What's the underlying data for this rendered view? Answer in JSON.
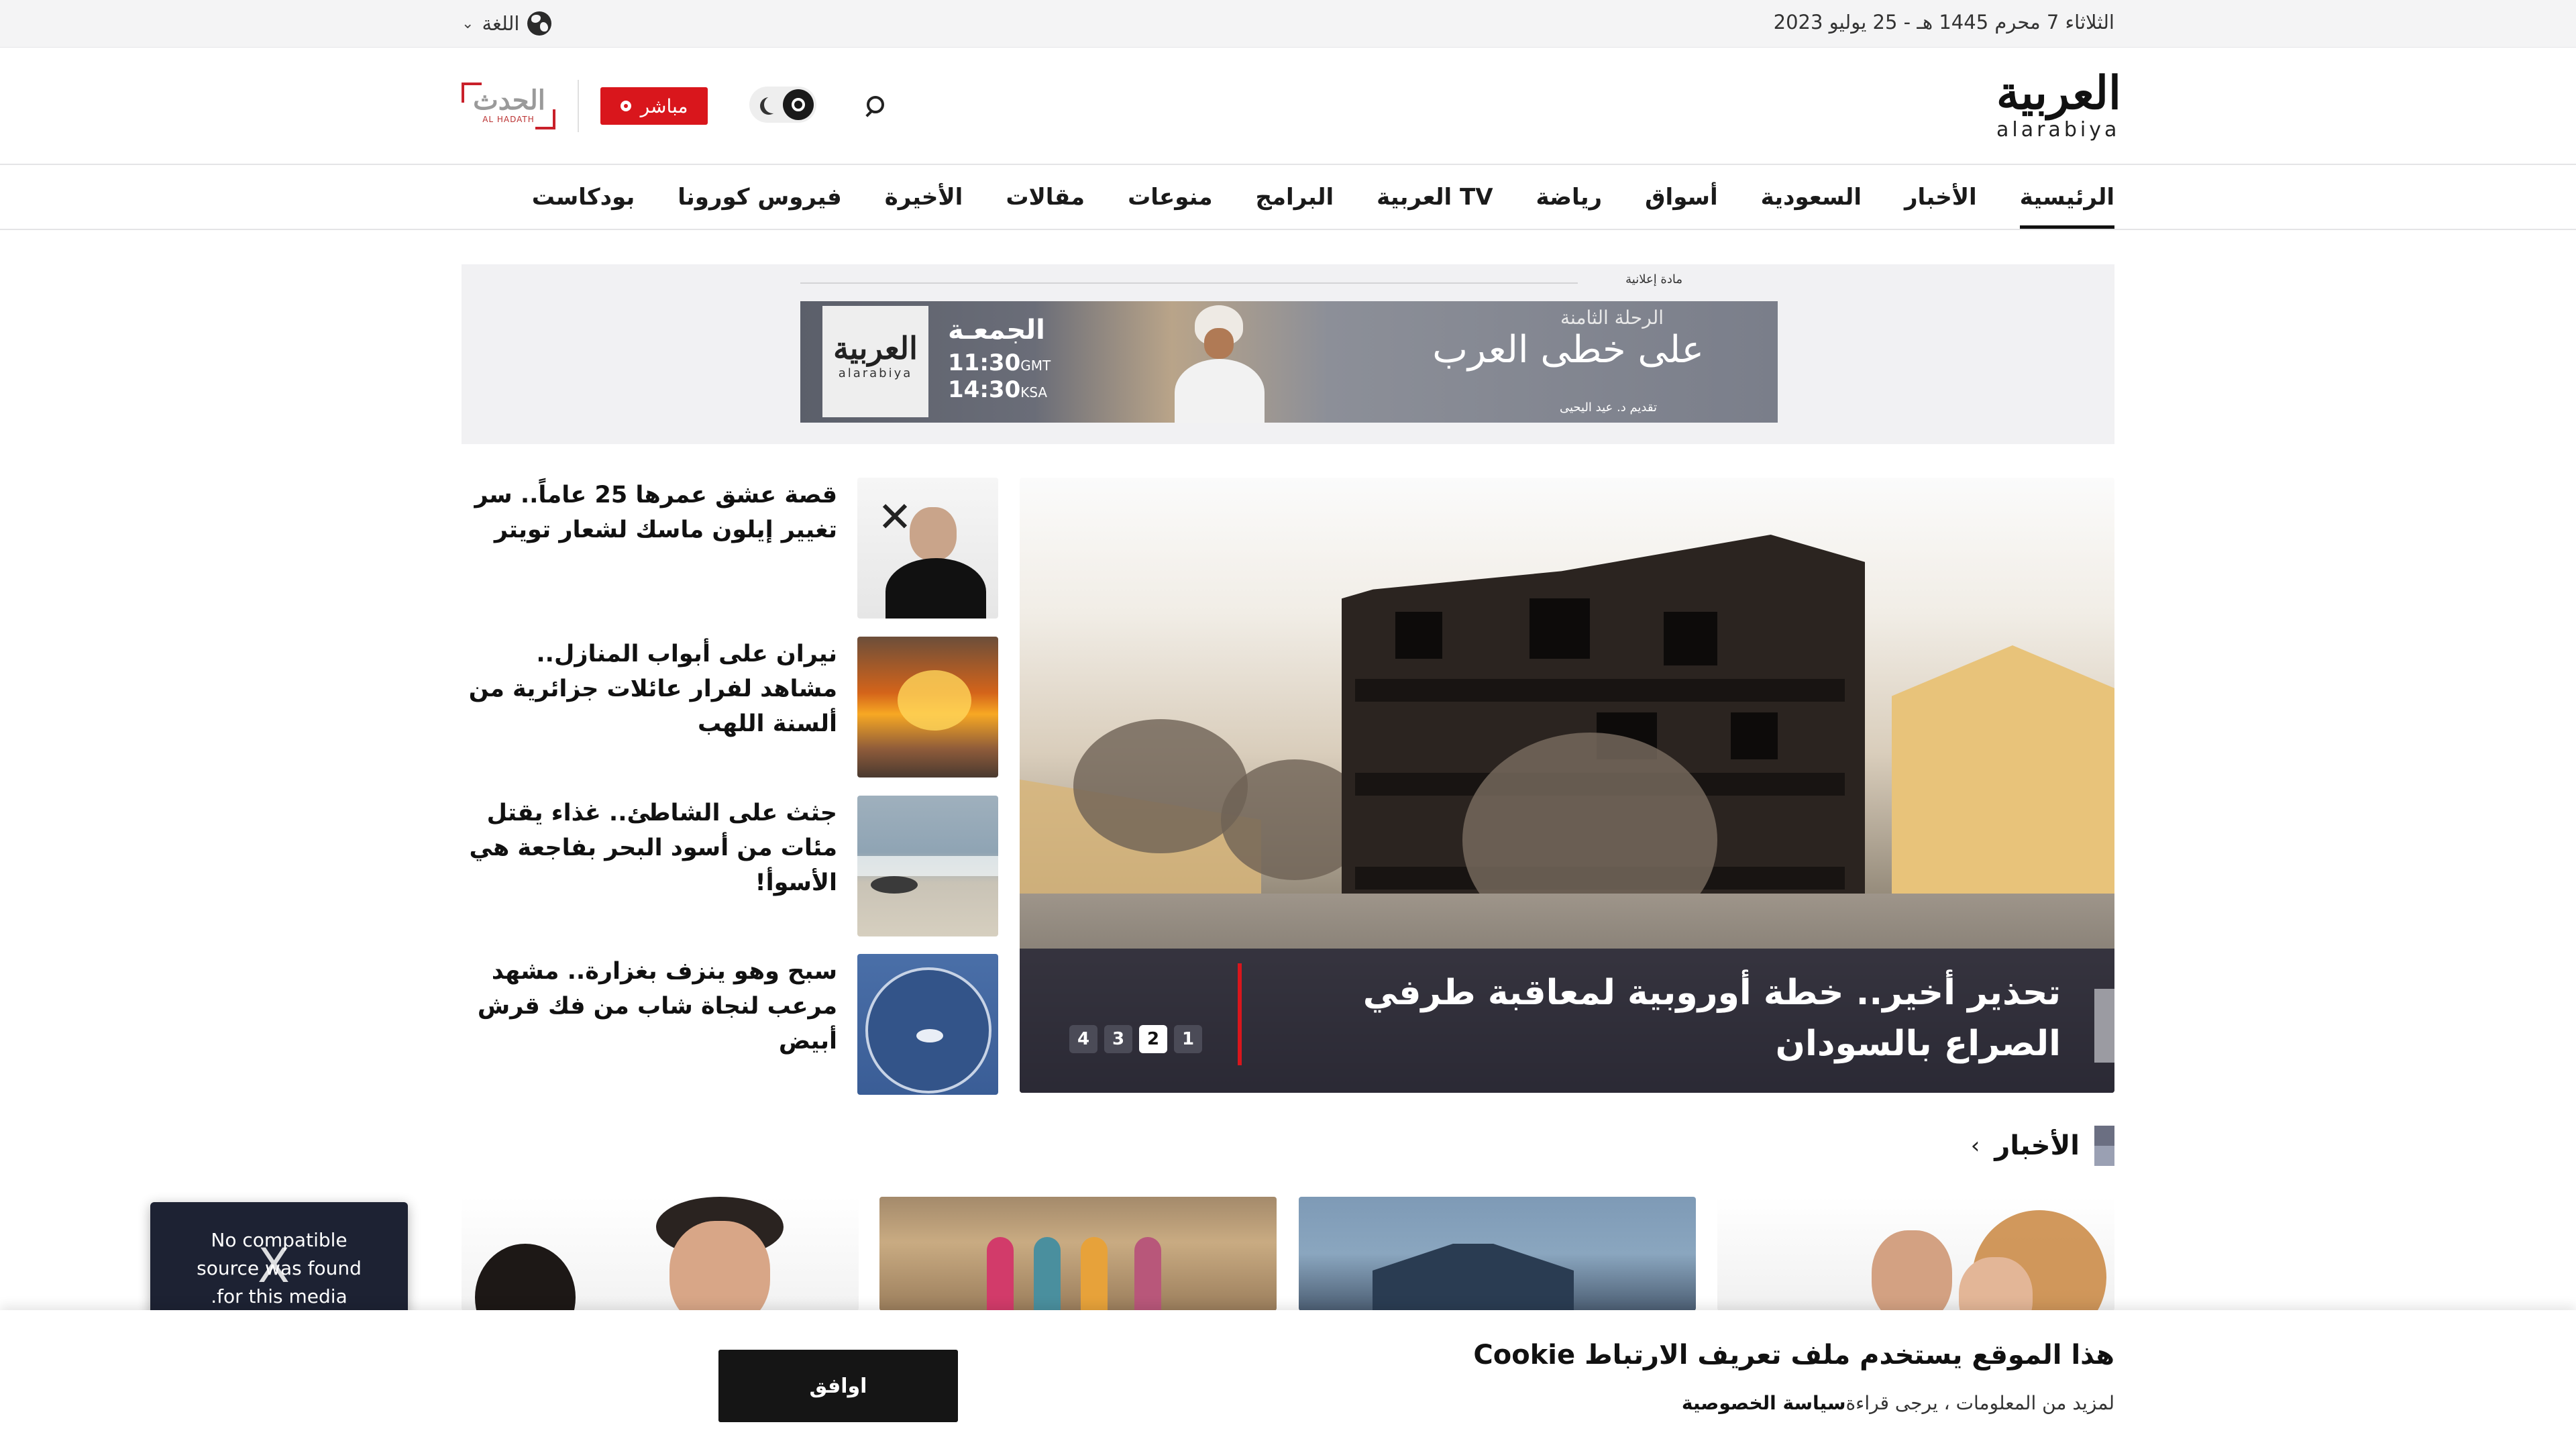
{
  "topbar": {
    "date": "الثلاثاء 7 محرم 1445 هـ - 25 يوليو 2023",
    "language_label": "اللغة"
  },
  "header": {
    "logo_ar": "العربية",
    "logo_en": "alarabiya",
    "live_label": "مباشر",
    "hadath_logo_ar": "الحدث",
    "hadath_logo_en": "AL HADATH"
  },
  "nav": {
    "items": [
      {
        "label": "الرئيسية",
        "active": true
      },
      {
        "label": "الأخبار"
      },
      {
        "label": "السعودية"
      },
      {
        "label": "أسواق"
      },
      {
        "label": "رياضة"
      },
      {
        "label": "العربية TV"
      },
      {
        "label": "البرامج"
      },
      {
        "label": "منوعات"
      },
      {
        "label": "مقالات"
      },
      {
        "label": "الأخيرة"
      },
      {
        "label": "فيروس كورونا"
      },
      {
        "label": "بودكاست"
      }
    ]
  },
  "ad": {
    "label": "مادة إعلانية",
    "day": "الجمعـة",
    "time_gmt": "11:30",
    "gmt_suffix": "GMT",
    "time_ksa": "14:30",
    "ksa_suffix": "KSA",
    "show_subtitle": "الرحلة الثامنة",
    "show_title": "على خطى العرب",
    "show_host": "تقديم د. عيد اليحيى",
    "logo_ar": "العربية",
    "logo_en": "alarabiya"
  },
  "hero": {
    "title": "تحذير أخير.. خطة أوروبية لمعاقبة طرفي الصراع بالسودان",
    "slides": [
      "1",
      "2",
      "3",
      "4"
    ],
    "active_slide": "2"
  },
  "side_news": [
    {
      "title": "قصة عشق عمرها 25 عاماً.. سر تغيير إيلون ماسك لشعار تويتر",
      "thumb": "elon-musk-x"
    },
    {
      "title": "نيران على أبواب المنازل.. مشاهد لفرار عائلات جزائرية من ألسنة اللهب",
      "thumb": "fire"
    },
    {
      "title": "جثث على الشاطئ.. غذاء يقتل مئات من أسود البحر بفاجعة هي الأسوأ!",
      "thumb": "beach"
    },
    {
      "title": "سبح وهو ينزف بغزارة.. مشهد مرعب لنجاة شاب من فك قرش أبيض",
      "thumb": "shark"
    }
  ],
  "section": {
    "title": "الأخبار"
  },
  "video_error": {
    "line1": "No compatible",
    "line2": "source was found",
    "line3": ".for this media",
    "close": "X"
  },
  "cookie": {
    "title": "هذا الموقع يستخدم ملف تعريف الارتباط Cookie",
    "text": "لمزيد من المعلومات ، يرجى قراءة",
    "link": "سياسة الخصوصية",
    "accept": "اوافق"
  },
  "colors": {
    "accent_red": "#d9161c",
    "caption_bg": "#1e1e2e",
    "topbar_bg": "#f4f4f5"
  }
}
